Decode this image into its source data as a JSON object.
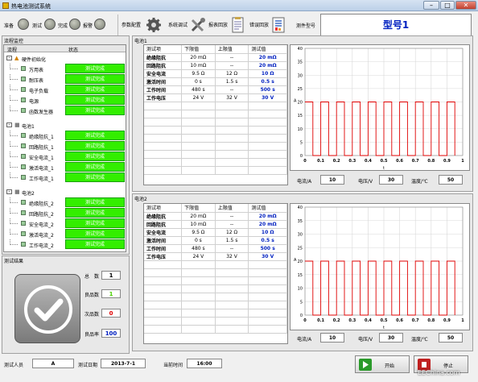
{
  "window": {
    "title": "热电池测试系统"
  },
  "toolbar": {
    "status_ready": "准备",
    "status_testing": "测试",
    "status_done": "完成",
    "status_alarm": "报警",
    "btn_params": "参数配置",
    "btn_debug": "系统调试",
    "btn_report": "报表回放",
    "btn_errors": "错误回放",
    "model_label": "测件型号",
    "model_value": "型号1"
  },
  "flow": {
    "title": "流程监控",
    "col_process": "流程",
    "col_status": "状态",
    "groups": [
      {
        "label": "硬件初始化",
        "items": [
          {
            "label": "万用表",
            "status": "测试完成"
          },
          {
            "label": "耐压表",
            "status": "测试完成"
          },
          {
            "label": "电子负载",
            "status": "测试完成"
          },
          {
            "label": "电源",
            "status": "测试完成"
          },
          {
            "label": "函数发生器",
            "status": "测试完成"
          }
        ]
      },
      {
        "label": "电池1",
        "items": [
          {
            "label": "绝缘阻抗_1",
            "status": "测试完成"
          },
          {
            "label": "回路阻抗_1",
            "status": "测试完成"
          },
          {
            "label": "安全电流_1",
            "status": "测试完成"
          },
          {
            "label": "激活电流_1",
            "status": "测试完成"
          },
          {
            "label": "工作电流_1",
            "status": "测试完成"
          }
        ]
      },
      {
        "label": "电池2",
        "items": [
          {
            "label": "绝缘阻抗_2",
            "status": "测试完成"
          },
          {
            "label": "回路阻抗_2",
            "status": "测试完成"
          },
          {
            "label": "安全电流_2",
            "status": "测试完成"
          },
          {
            "label": "激活电流_2",
            "status": "测试完成"
          },
          {
            "label": "工作电流_2",
            "status": "测试完成"
          }
        ]
      }
    ]
  },
  "result": {
    "title": "测试结果",
    "total_label": "总　数",
    "total": "1",
    "good_label": "良品数",
    "good": "1",
    "bad_label": "次品数",
    "bad": "0",
    "rate_label": "良品率",
    "rate": "100"
  },
  "battery1": {
    "title": "电池1",
    "headers": [
      "测试项",
      "下限值",
      "上限值",
      "测试值"
    ],
    "rows": [
      [
        "绝缘阻抗",
        "20 mΩ",
        "--",
        "20 mΩ"
      ],
      [
        "回路阻抗",
        "10 mΩ",
        "--",
        "20 mΩ"
      ],
      [
        "安全电流",
        "9.5 Ω",
        "12 Ω",
        "10 Ω"
      ],
      [
        "激活时间",
        "0 s",
        "1.5 s",
        "0.5 s"
      ],
      [
        "工作时间",
        "480 s",
        "--",
        "500 s"
      ],
      [
        "工作电压",
        "24 V",
        "32 V",
        "30 V"
      ]
    ],
    "current_label": "电流/A",
    "current": "10",
    "voltage_label": "电压/V",
    "voltage": "30",
    "temp_label": "温度/℃",
    "temp": "50"
  },
  "battery2": {
    "title": "电池2",
    "headers": [
      "测试项",
      "下限值",
      "上限值",
      "测试值"
    ],
    "rows": [
      [
        "绝缘阻抗",
        "20 mΩ",
        "--",
        "20 mΩ"
      ],
      [
        "回路阻抗",
        "10 mΩ",
        "--",
        "20 mΩ"
      ],
      [
        "安全电流",
        "9.5 Ω",
        "12 Ω",
        "10 Ω"
      ],
      [
        "激活时间",
        "0 s",
        "1.5 s",
        "0.5 s"
      ],
      [
        "工作时间",
        "480 s",
        "--",
        "500 s"
      ],
      [
        "工作电压",
        "24 V",
        "32 V",
        "30 V"
      ]
    ],
    "current_label": "电流/A",
    "current": "10",
    "voltage_label": "电压/V",
    "voltage": "30",
    "temp_label": "温度/℃",
    "temp": "50"
  },
  "chart_data": [
    {
      "type": "line",
      "ylabel": "A",
      "xlabel": "t",
      "xlim": [
        0,
        1
      ],
      "ylim": [
        0,
        40
      ],
      "yticks": [
        "0",
        "5",
        "10",
        "15",
        "20",
        "25",
        "30",
        "35",
        "40"
      ],
      "xticks": [
        "0",
        "0.1",
        "0.2",
        "0.3",
        "0.4",
        "0.5",
        "0.6",
        "0.7",
        "0.8",
        "0.9",
        "1"
      ],
      "series": [
        {
          "x": [
            0,
            0.05,
            0.05,
            0.1,
            0.1,
            0.15,
            0.15,
            0.2,
            0.2,
            0.25,
            0.25,
            0.3,
            0.3,
            0.35,
            0.35,
            0.4,
            0.4,
            0.45,
            0.45,
            0.5,
            0.5,
            0.55,
            0.55,
            0.6,
            0.6,
            0.65,
            0.65,
            0.7,
            0.7,
            0.75,
            0.75,
            0.8,
            0.8,
            0.85,
            0.85,
            0.9,
            0.9,
            0.95,
            0.95
          ],
          "y": [
            20,
            20,
            0,
            0,
            20,
            20,
            0,
            0,
            20,
            20,
            0,
            0,
            20,
            20,
            0,
            0,
            20,
            20,
            0,
            0,
            20,
            20,
            0,
            0,
            20,
            20,
            0,
            0,
            20,
            20,
            0,
            0,
            20,
            20,
            0,
            0,
            20,
            20,
            0
          ]
        }
      ],
      "color": "#e00000"
    },
    {
      "type": "line",
      "ylabel": "A",
      "xlabel": "t",
      "xlim": [
        0,
        1
      ],
      "ylim": [
        0,
        40
      ],
      "yticks": [
        "0",
        "5",
        "10",
        "15",
        "20",
        "25",
        "30",
        "35",
        "40"
      ],
      "xticks": [
        "0",
        "0.1",
        "0.2",
        "0.3",
        "0.4",
        "0.5",
        "0.6",
        "0.7",
        "0.8",
        "0.9",
        "1"
      ],
      "series": [
        {
          "x": [
            0,
            0.05,
            0.05,
            0.1,
            0.1,
            0.15,
            0.15,
            0.2,
            0.2,
            0.25,
            0.25,
            0.3,
            0.3,
            0.35,
            0.35,
            0.4,
            0.4,
            0.45,
            0.45,
            0.5,
            0.5,
            0.55,
            0.55,
            0.6,
            0.6,
            0.65,
            0.65,
            0.7,
            0.7,
            0.75,
            0.75,
            0.8,
            0.8,
            0.85,
            0.85,
            0.9,
            0.9,
            0.95,
            0.95
          ],
          "y": [
            20,
            20,
            0,
            0,
            20,
            20,
            0,
            0,
            20,
            20,
            0,
            0,
            20,
            20,
            0,
            0,
            20,
            20,
            0,
            0,
            20,
            20,
            0,
            0,
            20,
            20,
            0,
            0,
            20,
            20,
            0,
            0,
            20,
            20,
            0,
            0,
            20,
            20,
            0
          ]
        }
      ],
      "color": "#e00000"
    }
  ],
  "footer": {
    "tester_label": "测试人员",
    "tester": "A",
    "date_label": "测试日期",
    "date": "2013-7-1",
    "time_label": "当前时间",
    "time": "16:00",
    "start_label": "开始",
    "stop_label": "停止",
    "watermark": "EEChina.com"
  }
}
